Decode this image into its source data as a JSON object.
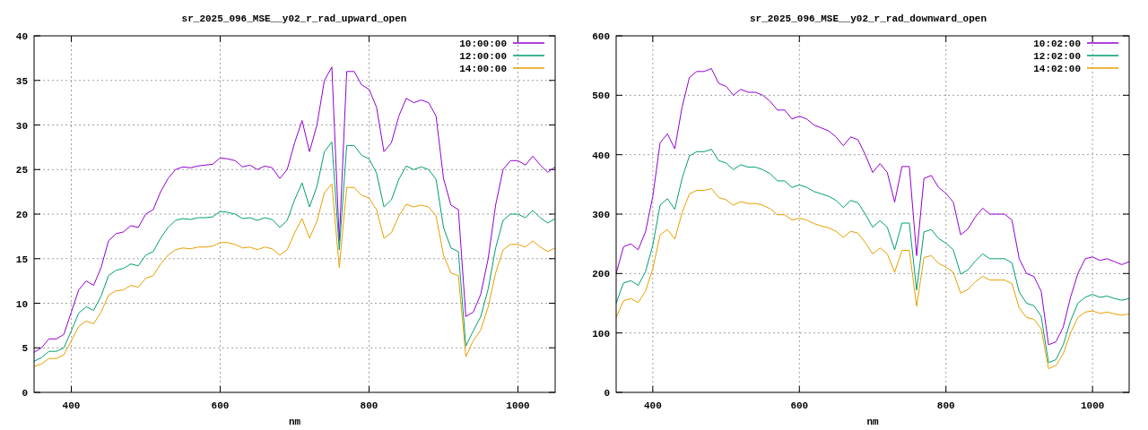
{
  "charts": [
    {
      "chart_data": {
        "type": "line",
        "title": "sr_2025_096_MSE__y02_r_rad_upward_open",
        "xlabel": "nm",
        "grid": true,
        "legend": true,
        "xlim": [
          350,
          1050
        ],
        "ylim": [
          0,
          40
        ],
        "xticks": [
          400,
          600,
          800,
          1000
        ],
        "yticks": [
          0,
          5,
          10,
          15,
          20,
          25,
          30,
          35,
          40
        ],
        "x": [
          350,
          360,
          370,
          380,
          390,
          400,
          410,
          420,
          430,
          440,
          450,
          460,
          470,
          480,
          490,
          500,
          510,
          520,
          530,
          540,
          550,
          560,
          570,
          580,
          590,
          600,
          610,
          620,
          630,
          640,
          650,
          660,
          670,
          680,
          690,
          700,
          710,
          720,
          730,
          740,
          750,
          760,
          770,
          780,
          790,
          800,
          810,
          820,
          830,
          840,
          850,
          860,
          870,
          880,
          890,
          900,
          910,
          920,
          930,
          940,
          950,
          960,
          970,
          980,
          990,
          1000,
          1010,
          1020,
          1030,
          1040,
          1050
        ],
        "series": [
          {
            "name": "10:00:00",
            "color": "#9400d3",
            "values": [
              4.5,
              5,
              6,
              6,
              6.5,
              9,
              11.5,
              12.5,
              12,
              14,
              17,
              17.8,
              18,
              18.7,
              18.5,
              20,
              20.5,
              22.5,
              24,
              25,
              25.3,
              25.2,
              25.4,
              25.5,
              25.6,
              26.3,
              26.2,
              26,
              25.3,
              25.5,
              25,
              25.4,
              25.2,
              24,
              25,
              28,
              30.5,
              27,
              30,
              35,
              36.5,
              17,
              36,
              36,
              34.5,
              34,
              32,
              27,
              28,
              31,
              33,
              32.5,
              32.8,
              32.5,
              31,
              24,
              21,
              20.5,
              8.5,
              9,
              11,
              15,
              21,
              25,
              26,
              26,
              25.5,
              26.5,
              25.5,
              24.7,
              25.3
            ]
          },
          {
            "name": "12:00:00",
            "color": "#009e73",
            "values": [
              3.5,
              3.9,
              4.6,
              4.6,
              5,
              6.9,
              8.9,
              9.6,
              9.2,
              10.8,
              13.1,
              13.7,
              13.9,
              14.4,
              14.2,
              15.4,
              15.8,
              17.3,
              18.5,
              19.3,
              19.5,
              19.4,
              19.6,
              19.6,
              19.7,
              20.3,
              20.2,
              20,
              19.5,
              19.6,
              19.3,
              19.6,
              19.4,
              18.5,
              19.3,
              21.6,
              23.5,
              20.8,
              23.1,
              27,
              28.1,
              16,
              27.7,
              27.7,
              26.6,
              26.2,
              24.6,
              20.8,
              21.6,
              23.9,
              25.4,
              25,
              25.3,
              25,
              23.9,
              18.5,
              16.2,
              15.8,
              5.2,
              6.9,
              8.5,
              11.6,
              16.2,
              19.3,
              20,
              20,
              19.6,
              20.4,
              19.6,
              19,
              19.5
            ]
          },
          {
            "name": "14:00:00",
            "color": "#e69f00",
            "values": [
              2.9,
              3.2,
              3.8,
              3.8,
              4.2,
              5.8,
              7.4,
              8,
              7.7,
              9,
              10.9,
              11.4,
              11.5,
              12,
              11.8,
              12.8,
              13.1,
              14.4,
              15.4,
              16,
              16.2,
              16.1,
              16.3,
              16.3,
              16.4,
              16.8,
              16.8,
              16.6,
              16.2,
              16.3,
              16,
              16.3,
              16.1,
              15.4,
              16,
              17.9,
              19.5,
              17.3,
              19.2,
              22.4,
              23.4,
              14,
              23,
              23,
              22.1,
              21.8,
              20.5,
              17.3,
              17.9,
              19.8,
              21.1,
              20.8,
              21,
              20.8,
              19.8,
              15.4,
              13.4,
              13.1,
              4,
              5.8,
              7,
              9.6,
              13.4,
              16,
              16.6,
              16.6,
              16.3,
              17,
              16.3,
              15.8,
              16.2
            ]
          }
        ]
      }
    },
    {
      "chart_data": {
        "type": "line",
        "title": "sr_2025_096_MSE__y02_r_rad_downward_open",
        "xlabel": "nm",
        "grid": true,
        "legend": true,
        "xlim": [
          350,
          1050
        ],
        "ylim": [
          0,
          600
        ],
        "xticks": [
          400,
          600,
          800,
          1000
        ],
        "yticks": [
          0,
          100,
          200,
          300,
          400,
          500,
          600
        ],
        "x": [
          350,
          360,
          370,
          380,
          390,
          400,
          410,
          420,
          430,
          440,
          450,
          460,
          470,
          480,
          490,
          500,
          510,
          520,
          530,
          540,
          550,
          560,
          570,
          580,
          590,
          600,
          610,
          620,
          630,
          640,
          650,
          660,
          670,
          680,
          690,
          700,
          710,
          720,
          730,
          740,
          750,
          760,
          770,
          780,
          790,
          800,
          810,
          820,
          830,
          840,
          850,
          860,
          870,
          880,
          890,
          900,
          910,
          920,
          930,
          940,
          950,
          960,
          970,
          980,
          990,
          1000,
          1010,
          1020,
          1030,
          1040,
          1050
        ],
        "series": [
          {
            "name": "10:02:00",
            "color": "#9400d3",
            "values": [
              200,
              245,
              250,
              240,
              270,
              330,
              420,
              435,
              410,
              480,
              530,
              540,
              540,
              545,
              520,
              515,
              500,
              510,
              505,
              505,
              500,
              490,
              475,
              475,
              460,
              465,
              460,
              450,
              445,
              440,
              430,
              415,
              430,
              425,
              400,
              370,
              385,
              370,
              320,
              380,
              380,
              230,
              360,
              365,
              345,
              335,
              320,
              265,
              275,
              295,
              310,
              300,
              300,
              300,
              290,
              225,
              200,
              195,
              170,
              80,
              85,
              110,
              160,
              200,
              225,
              228,
              222,
              225,
              220,
              215,
              220
            ]
          },
          {
            "name": "12:02:00",
            "color": "#009e73",
            "values": [
              150,
              184,
              188,
              180,
              203,
              248,
              315,
              326,
              308,
              360,
              398,
              405,
              405,
              409,
              390,
              386,
              375,
              383,
              379,
              379,
              375,
              368,
              356,
              356,
              345,
              349,
              345,
              338,
              334,
              330,
              323,
              311,
              323,
              319,
              300,
              278,
              289,
              278,
              240,
              285,
              285,
              172,
              270,
              274,
              259,
              251,
              240,
              199,
              206,
              221,
              233,
              225,
              225,
              225,
              218,
              169,
              150,
              146,
              128,
              50,
              55,
              80,
              120,
              150,
              160,
              165,
              160,
              162,
              158,
              155,
              158
            ]
          },
          {
            "name": "14:02:00",
            "color": "#e69f00",
            "values": [
              126,
              154,
              158,
              151,
              170,
              208,
              265,
              274,
              258,
              302,
              334,
              340,
              340,
              343,
              328,
              324,
              315,
              321,
              318,
              318,
              315,
              309,
              299,
              299,
              290,
              293,
              290,
              284,
              280,
              277,
              271,
              261,
              271,
              268,
              252,
              233,
              243,
              233,
              202,
              239,
              239,
              145,
              227,
              230,
              217,
              211,
              202,
              167,
              173,
              186,
              195,
              189,
              189,
              189,
              183,
              142,
              126,
              123,
              107,
              40,
              45,
              65,
              100,
              126,
              135,
              137,
              133,
              135,
              132,
              130,
              132
            ]
          }
        ]
      }
    }
  ]
}
